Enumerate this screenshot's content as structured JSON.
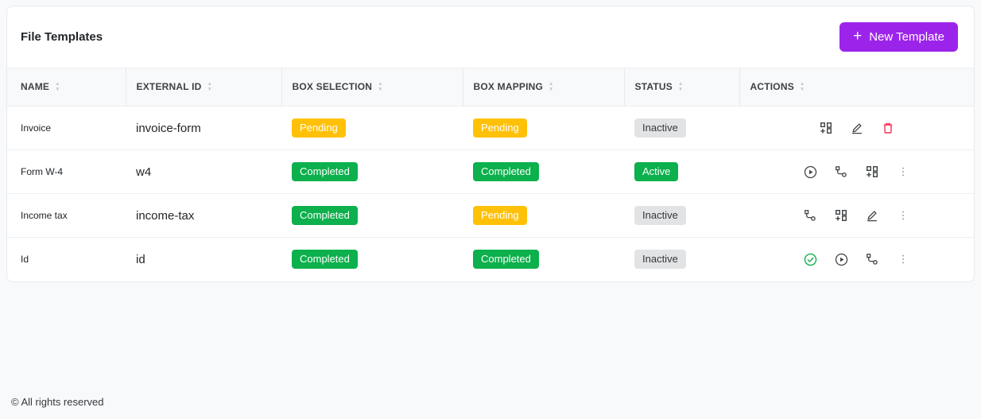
{
  "card": {
    "title": "File Templates"
  },
  "toolbar": {
    "new_template_label": "New Template",
    "plus_glyph": "+"
  },
  "colors": {
    "accent_purple": "#9c24ea",
    "badge_warning": "#ffc107",
    "badge_success": "#0cb04c",
    "badge_neutral": "#e2e3e5",
    "danger_red": "#f93154",
    "page_background": "#f8f9fa"
  },
  "table": {
    "columns": [
      {
        "label": "NAME",
        "sortable": true
      },
      {
        "label": "EXTERNAL ID",
        "sortable": true
      },
      {
        "label": "BOX SELECTION",
        "sortable": true
      },
      {
        "label": "BOX MAPPING",
        "sortable": true
      },
      {
        "label": "STATUS",
        "sortable": true
      },
      {
        "label": "ACTIONS",
        "sortable": true
      }
    ],
    "rows": [
      {
        "name": "Invoice",
        "external_id": "invoice-form",
        "box_selection": {
          "label": "Pending",
          "variant": "warning"
        },
        "box_mapping": {
          "label": "Pending",
          "variant": "warning"
        },
        "status": {
          "label": "Inactive",
          "variant": "neutral"
        },
        "actions": [
          {
            "icon": "grid-plus-icon"
          },
          {
            "icon": "edit-icon"
          },
          {
            "icon": "trash-icon",
            "color": "danger"
          }
        ]
      },
      {
        "name": "Form W-4",
        "external_id": "w4",
        "box_selection": {
          "label": "Completed",
          "variant": "success"
        },
        "box_mapping": {
          "label": "Completed",
          "variant": "success"
        },
        "status": {
          "label": "Active",
          "variant": "success"
        },
        "actions": [
          {
            "icon": "play-icon"
          },
          {
            "icon": "mapping-icon"
          },
          {
            "icon": "grid-plus-icon"
          },
          {
            "icon": "kebab-menu-icon",
            "color": "muted"
          }
        ]
      },
      {
        "name": "Income tax",
        "external_id": "income-tax",
        "box_selection": {
          "label": "Completed",
          "variant": "success"
        },
        "box_mapping": {
          "label": "Pending",
          "variant": "warning"
        },
        "status": {
          "label": "Inactive",
          "variant": "neutral"
        },
        "actions": [
          {
            "icon": "mapping-icon"
          },
          {
            "icon": "grid-plus-icon"
          },
          {
            "icon": "edit-icon"
          },
          {
            "icon": "kebab-menu-icon",
            "color": "muted"
          }
        ]
      },
      {
        "name": "Id",
        "external_id": "id",
        "box_selection": {
          "label": "Completed",
          "variant": "success"
        },
        "box_mapping": {
          "label": "Completed",
          "variant": "success"
        },
        "status": {
          "label": "Inactive",
          "variant": "neutral"
        },
        "actions": [
          {
            "icon": "check-circle-icon",
            "color": "success"
          },
          {
            "icon": "play-icon"
          },
          {
            "icon": "mapping-icon"
          },
          {
            "icon": "kebab-menu-icon",
            "color": "muted"
          }
        ]
      }
    ]
  },
  "footer": {
    "copyright": "© All rights reserved"
  }
}
